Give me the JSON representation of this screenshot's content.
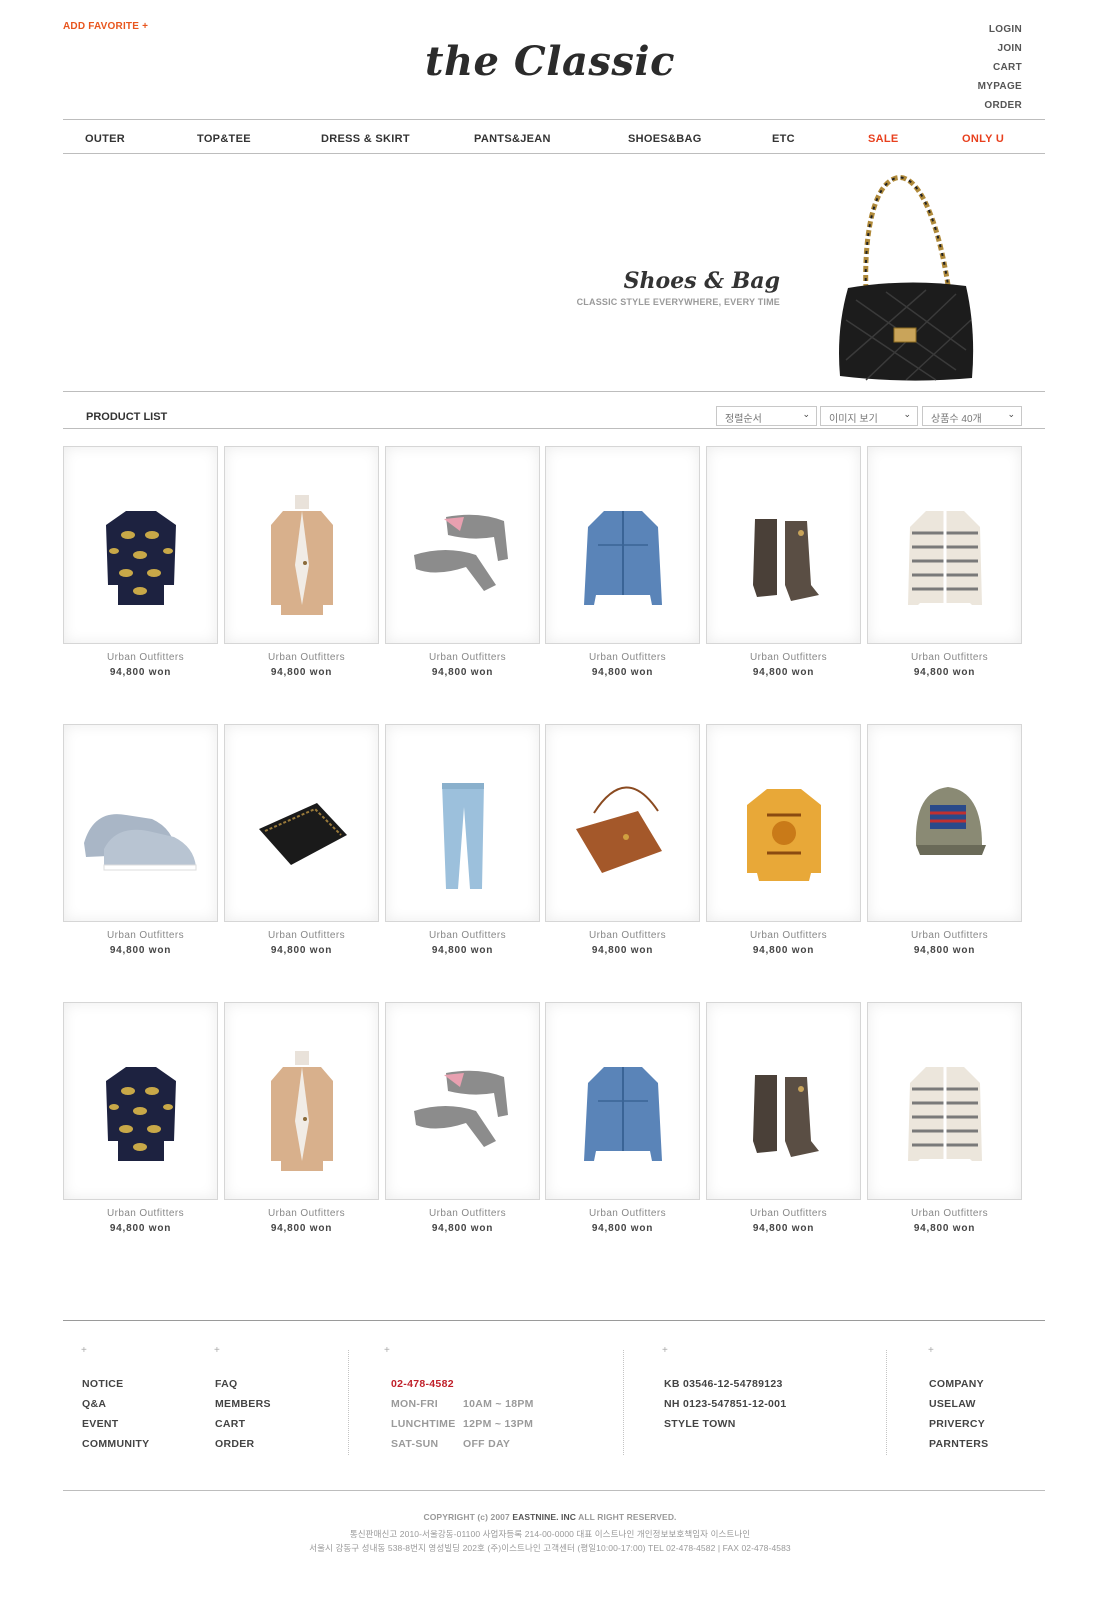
{
  "header": {
    "add_favorite": "ADD FAVORITE +",
    "logo": "the Classic",
    "util_menu": [
      "LOGIN",
      "JOIN",
      "CART",
      "MYPAGE",
      "ORDER"
    ]
  },
  "nav": {
    "items": [
      "OUTER",
      "TOP&TEE",
      "DRESS & SKIRT",
      "PANTS&JEAN",
      "SHOES&BAG",
      "ETC",
      "SALE",
      "ONLY U"
    ],
    "highlight_color": "#e8401e"
  },
  "banner": {
    "title": "Shoes & Bag",
    "subtitle": "CLASSIC STYLE EVERYWHERE, EVERY TIME",
    "image": "black-quilted-chain-bag"
  },
  "product_list": {
    "label": "PRODUCT LIST",
    "selects": [
      "정렬순서",
      "이미지 보기",
      "상품수 40개"
    ],
    "products": [
      {
        "image": "bow-sweater",
        "brand": "Urban Outfitters",
        "price": "94,800 won"
      },
      {
        "image": "beige-blazer",
        "brand": "Urban Outfitters",
        "price": "94,800 won"
      },
      {
        "image": "grey-heels",
        "brand": "Urban Outfitters",
        "price": "94,800 won"
      },
      {
        "image": "denim-jacket",
        "brand": "Urban Outfitters",
        "price": "94,800 won"
      },
      {
        "image": "brown-boots",
        "brand": "Urban Outfitters",
        "price": "94,800 won"
      },
      {
        "image": "striped-cardigan",
        "brand": "Urban Outfitters",
        "price": "94,800 won"
      },
      {
        "image": "grey-sneakers",
        "brand": "Urban Outfitters",
        "price": "94,800 won"
      },
      {
        "image": "black-clutch",
        "brand": "Urban Outfitters",
        "price": "94,800 won"
      },
      {
        "image": "skinny-jeans",
        "brand": "Urban Outfitters",
        "price": "94,800 won"
      },
      {
        "image": "brown-crossbody",
        "brand": "Urban Outfitters",
        "price": "94,800 won"
      },
      {
        "image": "yellow-sweatshirt",
        "brand": "Urban Outfitters",
        "price": "94,800 won"
      },
      {
        "image": "flag-cap",
        "brand": "Urban Outfitters",
        "price": "94,800 won"
      },
      {
        "image": "bow-sweater",
        "brand": "Urban Outfitters",
        "price": "94,800 won"
      },
      {
        "image": "beige-blazer",
        "brand": "Urban Outfitters",
        "price": "94,800 won"
      },
      {
        "image": "grey-heels",
        "brand": "Urban Outfitters",
        "price": "94,800 won"
      },
      {
        "image": "denim-jacket",
        "brand": "Urban Outfitters",
        "price": "94,800 won"
      },
      {
        "image": "brown-boots",
        "brand": "Urban Outfitters",
        "price": "94,800 won"
      },
      {
        "image": "striped-cardigan",
        "brand": "Urban Outfitters",
        "price": "94,800 won"
      }
    ]
  },
  "footer": {
    "plus": "+",
    "col1": [
      "NOTICE",
      "Q&A",
      "EVENT",
      "COMMUNITY"
    ],
    "col2": [
      "FAQ",
      "MEMBERS",
      "CART",
      "ORDER"
    ],
    "phone": "02-478-4582",
    "hours": [
      {
        "label": "MON-FRI",
        "value": "10AM ~ 18PM"
      },
      {
        "label": "LUNCHTIME",
        "value": "12PM ~ 13PM"
      },
      {
        "label": "SAT-SUN",
        "value": "OFF DAY"
      }
    ],
    "bank": [
      "KB 03546-12-54789123",
      "NH 0123-547851-12-001",
      "STYLE TOWN"
    ],
    "col5": [
      "COMPANY",
      "USELAW",
      "PRIVERCY",
      "PARNTERS"
    ],
    "copyright_1": "COPYRIGHT (c) 2007",
    "copyright_company": "EASTNINE. INC",
    "copyright_2": "ALL RIGHT RESERVED.",
    "info_line1": "통신판매신고 2010-서울강동-01100      사업자등록 214-00-0000    대표 이스트나인    개인정보보호책임자 이스트나인",
    "info_line2": "서울시 강동구 성내동 538-8번지 영성빌딩 202호 (주)이스트나인  고객센터 (평일10:00-17:00)   TEL 02-478-4582   |   FAX 02-478-4583",
    "phone_color": "#c0202a"
  }
}
